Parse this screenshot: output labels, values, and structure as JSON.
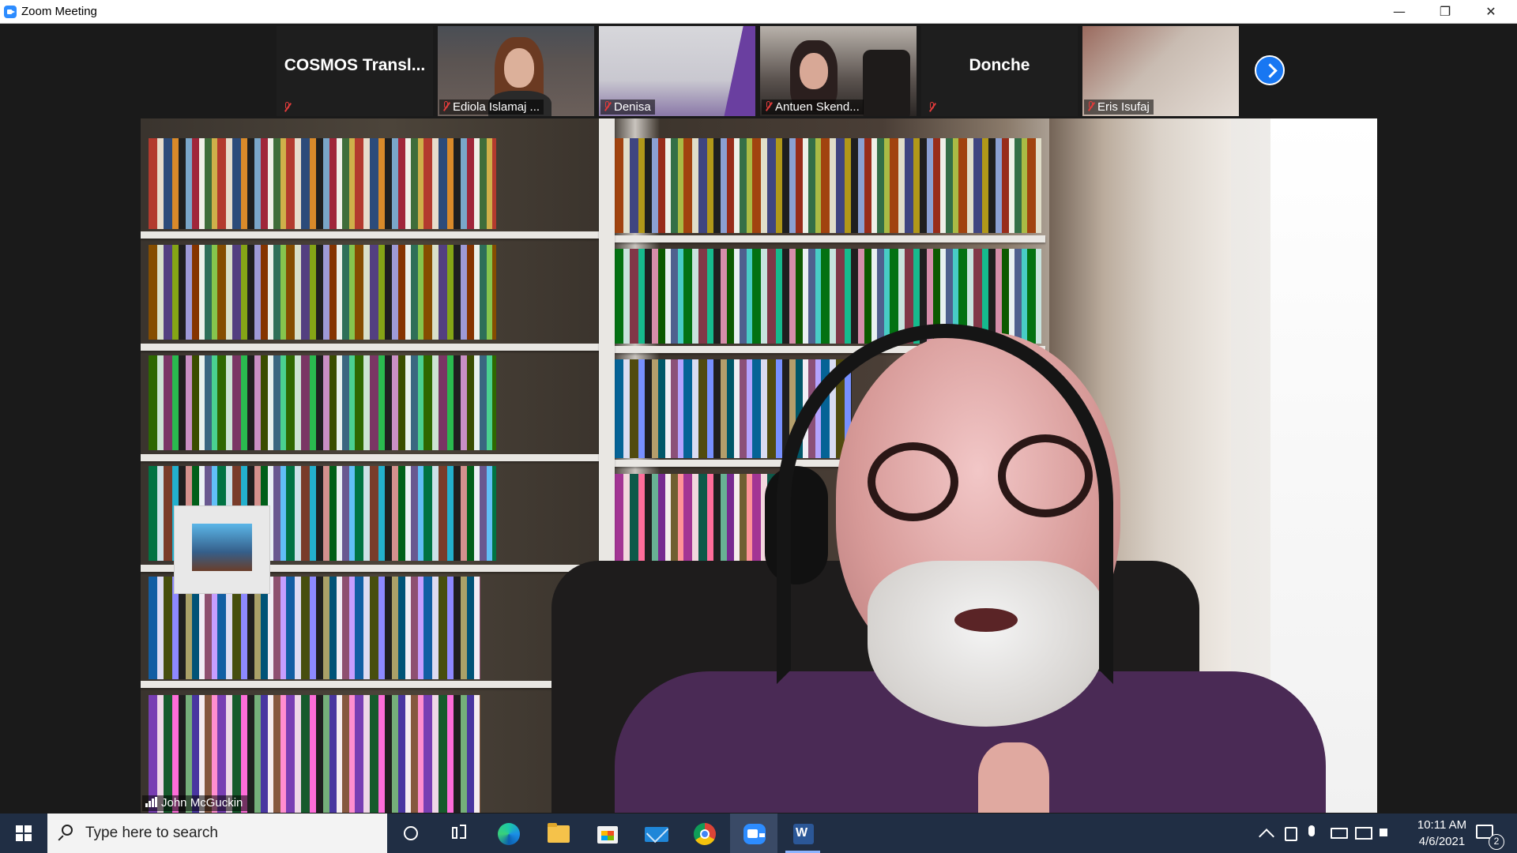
{
  "window": {
    "title": "Zoom Meeting",
    "minimize_glyph": "—",
    "maximize_glyph": "❐",
    "close_glyph": "✕"
  },
  "thumbnails": [
    {
      "name": "COSMOS  Transl...",
      "muted": true,
      "video": false
    },
    {
      "name": "Ediola Islamaj ...",
      "muted": true,
      "video": true
    },
    {
      "name": "Denisa",
      "muted": true,
      "video": true
    },
    {
      "name": "Antuen Skend...",
      "muted": true,
      "video": true
    },
    {
      "name": "Donche",
      "muted": true,
      "video": false
    },
    {
      "name": "Eris Isufaj",
      "muted": true,
      "video": true
    }
  ],
  "main_video": {
    "speaker_name": "John McGuckin"
  },
  "taskbar": {
    "search_placeholder": "Type here to search",
    "word_letter": "W",
    "clock_time": "10:11 AM",
    "clock_date": "4/6/2021",
    "notification_count": "2"
  },
  "colors": {
    "zoom_blue": "#2d8cff",
    "next_button": "#1877f2",
    "mute_red": "#e23b3b",
    "taskbar_bg": "#202e44"
  },
  "icons": [
    "zoom-app-icon",
    "muted-mic-icon",
    "chevron-right-icon",
    "signal-icon",
    "windows-start-icon",
    "search-icon",
    "cortana-icon",
    "task-view-icon",
    "edge-icon",
    "file-explorer-icon",
    "store-icon",
    "mail-icon",
    "chrome-icon",
    "zoom-icon",
    "word-icon",
    "notification-icon"
  ]
}
